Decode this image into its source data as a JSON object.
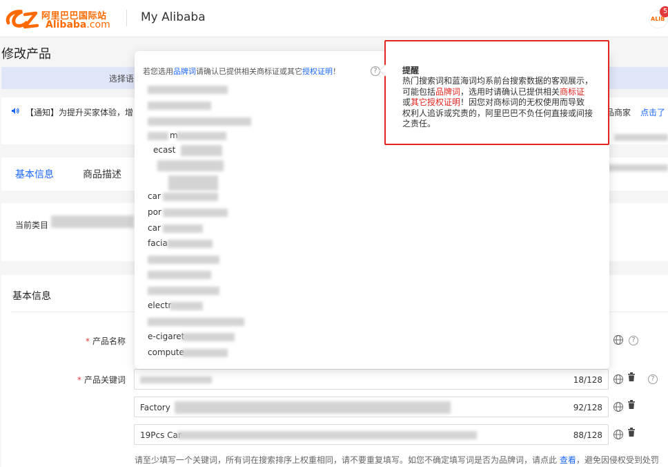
{
  "header": {
    "logo_cn": "阿里巴巴国际站",
    "logo_en": "Alibaba",
    "logo_en_suffix": ".com",
    "title": "My Alibaba",
    "avatar_text": "ALIB",
    "badge_count": "5"
  },
  "page": {
    "title": "修改产品",
    "steps_label": "选择语",
    "notice_icon": "speaker-icon",
    "notice_text": "【通知】为提升买家体验，增",
    "notice_right_text": "品商家",
    "notice_right_link": "点击了"
  },
  "tabs": [
    {
      "label": "基本信息",
      "active": true
    },
    {
      "label": "商品描述",
      "active": false
    }
  ],
  "category": {
    "label": "当前类目"
  },
  "form": {
    "section_title": "基本信息",
    "product_name_label": "产品名称",
    "keyword_label": "产品关键词",
    "keywords": [
      {
        "value": "",
        "count": "18/128"
      },
      {
        "value": "Factory",
        "count": "92/128"
      },
      {
        "value": "19Pcs Car",
        "count": "88/128"
      }
    ],
    "hint_before": "请至少填写一个关键词，所有词在搜索排序上权重相同，请不要重复填写。如您不确定填写词是否为品牌词，请点此",
    "hint_link": "查看",
    "hint_after": "，避免因侵权受到处罚"
  },
  "dropdown": {
    "tip_before": "若您选用",
    "tip_link1": "品牌词",
    "tip_middle": "请确认已提供相关商标证或其它",
    "tip_link2": "授权证明",
    "tip_end": "！",
    "items": [
      "",
      "",
      "",
      "m",
      "ecast",
      "",
      "",
      "car",
      "por",
      "car",
      "facia",
      "",
      "",
      "",
      "electr",
      "",
      "e-cigaret",
      "compute"
    ]
  },
  "reminder": {
    "title": "提醒",
    "body_1": "热门搜索词和蓝海词均系前台搜索数据的客观展示，可能包括",
    "body_red1": "品牌词",
    "body_2": "，选用时请确认已提供相关",
    "body_red2": "商标证",
    "body_3": "或",
    "body_red3": "其它授权证明",
    "body_4": "！因您对商标词的无权使用而导致权利人追诉或究责的，阿里巴巴不负任何直接或间接之责任。"
  },
  "colors": {
    "brand": "#ff6a00",
    "accent": "#1a66ff",
    "alert": "#e4231e"
  }
}
